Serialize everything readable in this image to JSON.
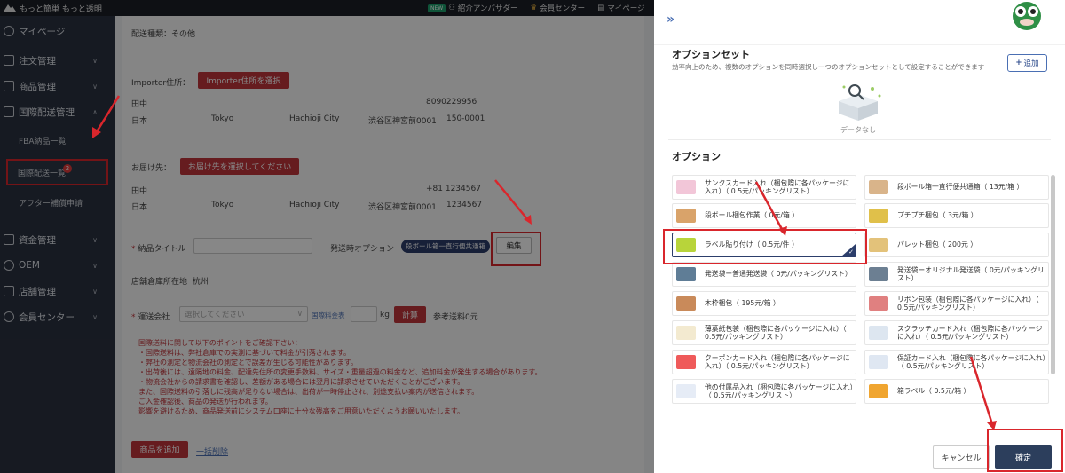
{
  "topbar": {
    "brand": "もっと簡単 もっと透明",
    "new_badge": "NEW",
    "ambassador": "紹介アンバサダー",
    "member_center": "会員センター",
    "mypage": "マイページ"
  },
  "sidebar": {
    "mypage": "マイページ",
    "orders": "注文管理",
    "products": "商品管理",
    "intl_shipping": "国際配送管理",
    "fba_list": "FBA納品一覧",
    "intl_list": "国際配送一覧",
    "intl_badge": "2",
    "after_service": "アフター補償申請",
    "funds": "資金管理",
    "oem": "OEM",
    "shops": "店舗管理",
    "member_center": "会員センター"
  },
  "main": {
    "shipping_type": "配送種類：その他",
    "importer_label": "Importer住所：",
    "importer_button": "Importer住所を選択",
    "importer": {
      "name": "田中",
      "phone": "8090229956",
      "country": "日本",
      "city": "Tokyo",
      "district": "Hachioji City",
      "street": "渋谷区神宮前0001",
      "zip": "150-0001"
    },
    "delivery_label": "お届け先：",
    "delivery_button": "お届け先を選択してください",
    "delivery": {
      "name": "田中",
      "phone": "+81 1234567",
      "country": "日本",
      "city": "Tokyo",
      "district": "Hachioji City",
      "street": "渋谷区神宮前0001",
      "zip": "1234567"
    },
    "delivery_title_label": "納品タイトル",
    "ship_option_label": "発送時オプション",
    "ship_option_tag": "段ボール箱一直行便共通箱",
    "edit_button": "編集",
    "warehouse_label": "店舗倉庫所在地",
    "warehouse_value": "杭州",
    "carrier_label": "運送会社",
    "carrier_placeholder": "選択してください",
    "intl_rates_link": "国際料金表",
    "kg_unit": "kg",
    "calc_button": "計算",
    "ref_fee": "参考送料0元",
    "notes": [
      "国際送料に関して以下のポイントをご確認下さい：",
      "・国際送料は、弊社倉庫での実測に基づいて料金が引落されます。",
      "・弊社の測定と物流会社の測定とで誤差が生じる可能性があります。",
      "・出荷後には、遠隔地の料金、配達先住所の変更手数料、サイズ・重量超過の料金など、追加料金が発生する場合があります。",
      "・物流会社からの請求書を確認し、差額がある場合には翌月に請求させていただくことがございます。",
      "また、国際送料の引落しに残高が足りない場合は、出荷が一時停止され、別途支払い案内が送信されます。",
      "ご入金確認後、商品の発送が行われます。",
      "影響を避けるため、商品発送前にシステム口座に十分な残高をご用意いただくようお願いいたします。"
    ],
    "add_product_button": "商品を追加",
    "bulk_delete_link": "一括削除"
  },
  "drawer": {
    "option_set_title": "オプションセット",
    "option_set_desc": "効率向上のため、複数のオプションを同時選択し一つのオプションセットとして設定することができます",
    "add_button": "追加",
    "empty_text": "データなし",
    "options_title": "オプション",
    "options": [
      {
        "label": "サンクスカード入れ（梱包際に各パッケージに入れ）（ 0.5元/パッキングリスト）",
        "color": "#f2c6d8"
      },
      {
        "label": "段ボール箱一直行便共通箱（ 13元/箱 ）",
        "color": "#d9b48a"
      },
      {
        "label": "段ボール梱包作業（ 0元/箱 ）",
        "color": "#d9a36a"
      },
      {
        "label": "プチプチ梱包（ 3元/箱 ）",
        "color": "#e0c04a"
      },
      {
        "label": "ラベル貼り付け（ 0.5元/件 ）",
        "color": "#b8d43a",
        "selected": true
      },
      {
        "label": "パレット梱包（ 200元 ）",
        "color": "#e3c27a"
      },
      {
        "label": "発送袋ー普通発送袋（ 0元/パッキングリスト）",
        "color": "#5f7d96"
      },
      {
        "label": "発送袋ーオリジナル発送袋（ 0元/パッキングリスト）",
        "color": "#6c7f92"
      },
      {
        "label": "木枠梱包（ 195元/箱 ）",
        "color": "#c98a5a"
      },
      {
        "label": "リボン包装（梱包際に各パッケージに入れ）（ 0.5元/パッキングリスト）",
        "color": "#e08080"
      },
      {
        "label": "薄葉紙包装（梱包際に各パッケージに入れ）（ 0.5元/パッキングリスト）",
        "color": "#f3ead0"
      },
      {
        "label": "スクラッチカード入れ（梱包際に各パッケージに入れ）（ 0.5元/パッキングリスト）",
        "color": "#dde6f0"
      },
      {
        "label": "クーポンカード入れ（梱包際に各パッケージに入れ）（ 0.5元/パッキングリスト）",
        "color": "#ef5a5a"
      },
      {
        "label": "保証カード入れ（梱包際に各パッケージに入れ）（ 0.5元/パッキングリスト）",
        "color": "#dfe7f2"
      },
      {
        "label": "他の付属品入れ（梱包際に各パッケージに入れ）（ 0.5元/パッキングリスト）",
        "color": "#e6ecf6"
      },
      {
        "label": "箱ラベル（ 0.5元/箱 ）",
        "color": "#f0a530"
      }
    ],
    "cancel_button": "キャンセル",
    "confirm_button": "確定"
  }
}
